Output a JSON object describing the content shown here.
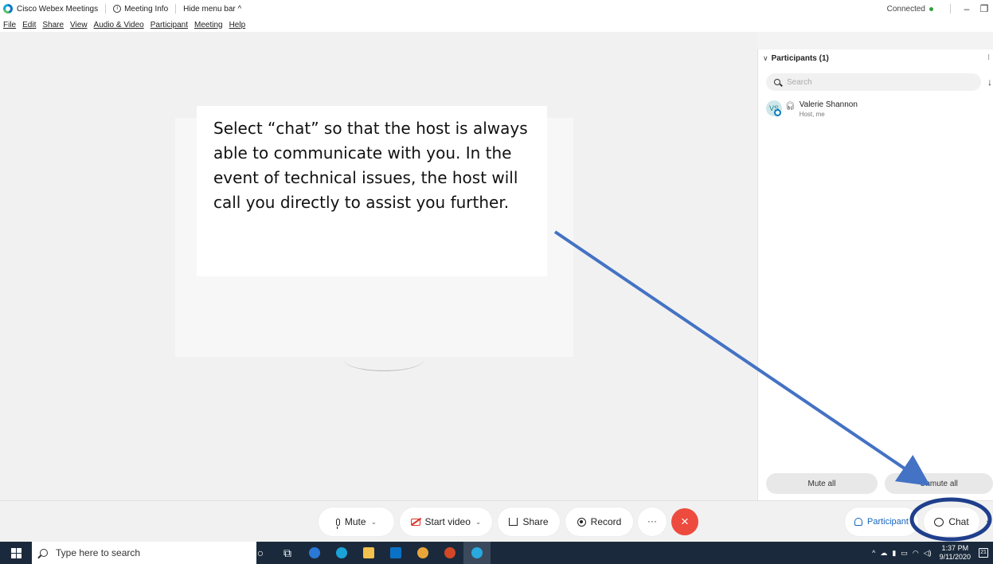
{
  "titlebar": {
    "app_title": "Cisco Webex Meetings",
    "meeting_info": "Meeting Info",
    "hide_menu": "Hide menu bar ^",
    "status": "Connected",
    "minimize": "–",
    "restore": "❐"
  },
  "menu": {
    "items": [
      "File",
      "Edit",
      "Share",
      "View",
      "Audio & Video",
      "Participant",
      "Meeting",
      "Help"
    ]
  },
  "callout": {
    "text": "Select “chat” so that the host is always able to communicate with you. In the event of technical issues, the host will call you directly to assist you further."
  },
  "participants_panel": {
    "header": "Participants (1)",
    "search_placeholder": "Search",
    "participant": {
      "initials": "VS",
      "name": "Valerie Shannon",
      "role": "Host, me"
    },
    "mute_all": "Mute all",
    "unmute_all": "Unmute all"
  },
  "controls": {
    "mute": "Mute",
    "start_video": "Start video",
    "share": "Share",
    "record": "Record",
    "more": "···",
    "end": "×",
    "participants": "Participant",
    "chat": "Chat"
  },
  "taskbar": {
    "search_placeholder": "Type here to search",
    "time": "1:37 PM",
    "date": "9/11/2020",
    "notifications": "21"
  },
  "colors": {
    "accent_blue": "#4472c4",
    "end_red": "#ed4b3e",
    "highlight_ring": "#1f3f8c"
  },
  "icons": [
    "webex-logo-icon",
    "info-icon",
    "search-icon",
    "headset-icon",
    "mic-icon",
    "camera-off-icon",
    "share-icon",
    "record-icon",
    "person-icon",
    "chat-icon",
    "windows-icon"
  ]
}
